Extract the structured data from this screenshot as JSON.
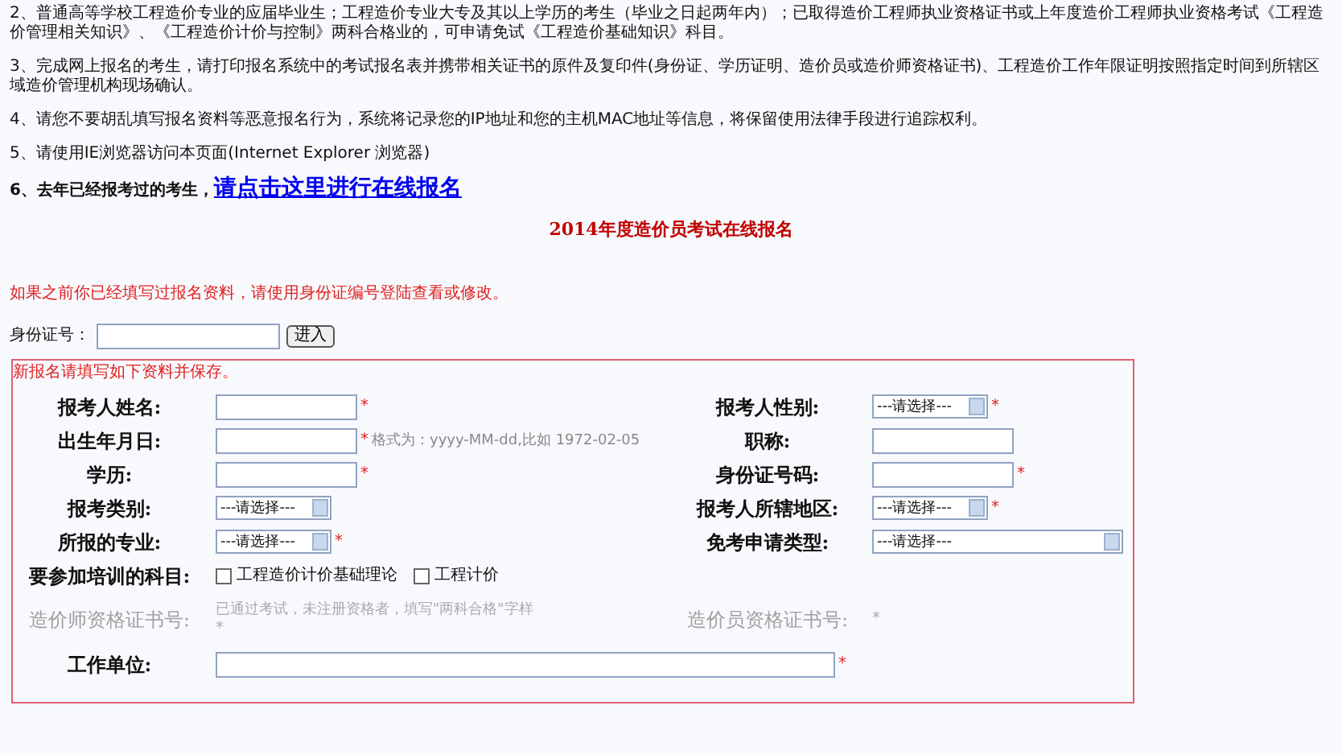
{
  "notes": [
    {
      "text": "2、普通高等学校工程造价专业的应届毕业生；工程造价专业大专及其以上学历的考生（毕业之日起两年内）；已取得造价工程师执业资格证书或上年度造价工程师执业资格考试《工程造价管理相关知识》、《工程造价计价与控制》两科合格业的，可申请免试《工程造价基础知识》科目。"
    },
    {
      "text": "3、完成网上报名的考生，请打印报名系统中的考试报名表并携带相关证书的原件及复印件(身份证、学历证明、造价员或造价师资格证书)、工程造价工作年限证明按照指定时间到所辖区域造价管理机构现场确认。"
    },
    {
      "text": "4、请您不要胡乱填写报名资料等恶意报名行为，系统将记录您的IP地址和您的主机MAC地址等信息，将保留使用法律手段进行追踪权利。"
    },
    {
      "text": "5、请使用IE浏览器访问本页面(Internet Explorer 浏览器)"
    }
  ],
  "returning": {
    "text": "6、去年已经报考过的考生，",
    "link": "请点击这里进行在线报名"
  },
  "title": "2014年度造价员考试在线报名",
  "notice": "如果之前你已经填写过报名资料，请使用身份证编号登陆查看或修改。",
  "login": {
    "label": "身份证号：",
    "button": "进入"
  },
  "form": {
    "intro": "新报名请填写如下资料并保存。",
    "rows": [
      {
        "left": {
          "kind": "text",
          "label": "报考人姓名:",
          "mark": "*"
        },
        "right": {
          "kind": "select",
          "label": "报考人性别:",
          "value": "---请选择---",
          "mark": "*"
        }
      },
      {
        "left": {
          "kind": "text",
          "label": "出生年月日:",
          "mark": "*",
          "hint": "格式为：yyyy-MM-dd,比如  1972-02-05"
        },
        "right": {
          "kind": "text",
          "label": "职称:"
        }
      },
      {
        "left": {
          "kind": "text",
          "label": "学历:",
          "mark": "*"
        },
        "right": {
          "kind": "text",
          "label": "身份证号码:",
          "mark": "*"
        }
      },
      {
        "left": {
          "kind": "select",
          "label": "报考类别:",
          "value": "---请选择---"
        },
        "right": {
          "kind": "select",
          "label": "报考人所辖地区:",
          "value": "---请选择---",
          "mark": "*"
        }
      },
      {
        "left": {
          "kind": "select",
          "label": "所报的专业:",
          "value": "---请选择---",
          "mark": "*"
        },
        "right": {
          "kind": "wideselect",
          "label": "免考申请类型:",
          "value": "---请选择---"
        }
      },
      {
        "left": {
          "kind": "checks",
          "label": "要参加培训的科目:",
          "options": [
            {
              "label": "工程造价计价基础理论",
              "checked": false
            },
            {
              "label": "工程计价",
              "checked": false
            }
          ]
        }
      },
      {
        "left": {
          "kind": "note",
          "label": "造价师资格证书号:",
          "disabled": true,
          "note": "已通过考试，未注册资格者，填写\"两科合格\"字样",
          "mark": "*"
        },
        "right": {
          "kind": "note",
          "label": "造价员资格证书号:",
          "disabled": true,
          "mark": "*"
        }
      },
      {
        "left": {
          "kind": "widetext",
          "label": "工作单位:",
          "mark": "*"
        }
      }
    ]
  }
}
